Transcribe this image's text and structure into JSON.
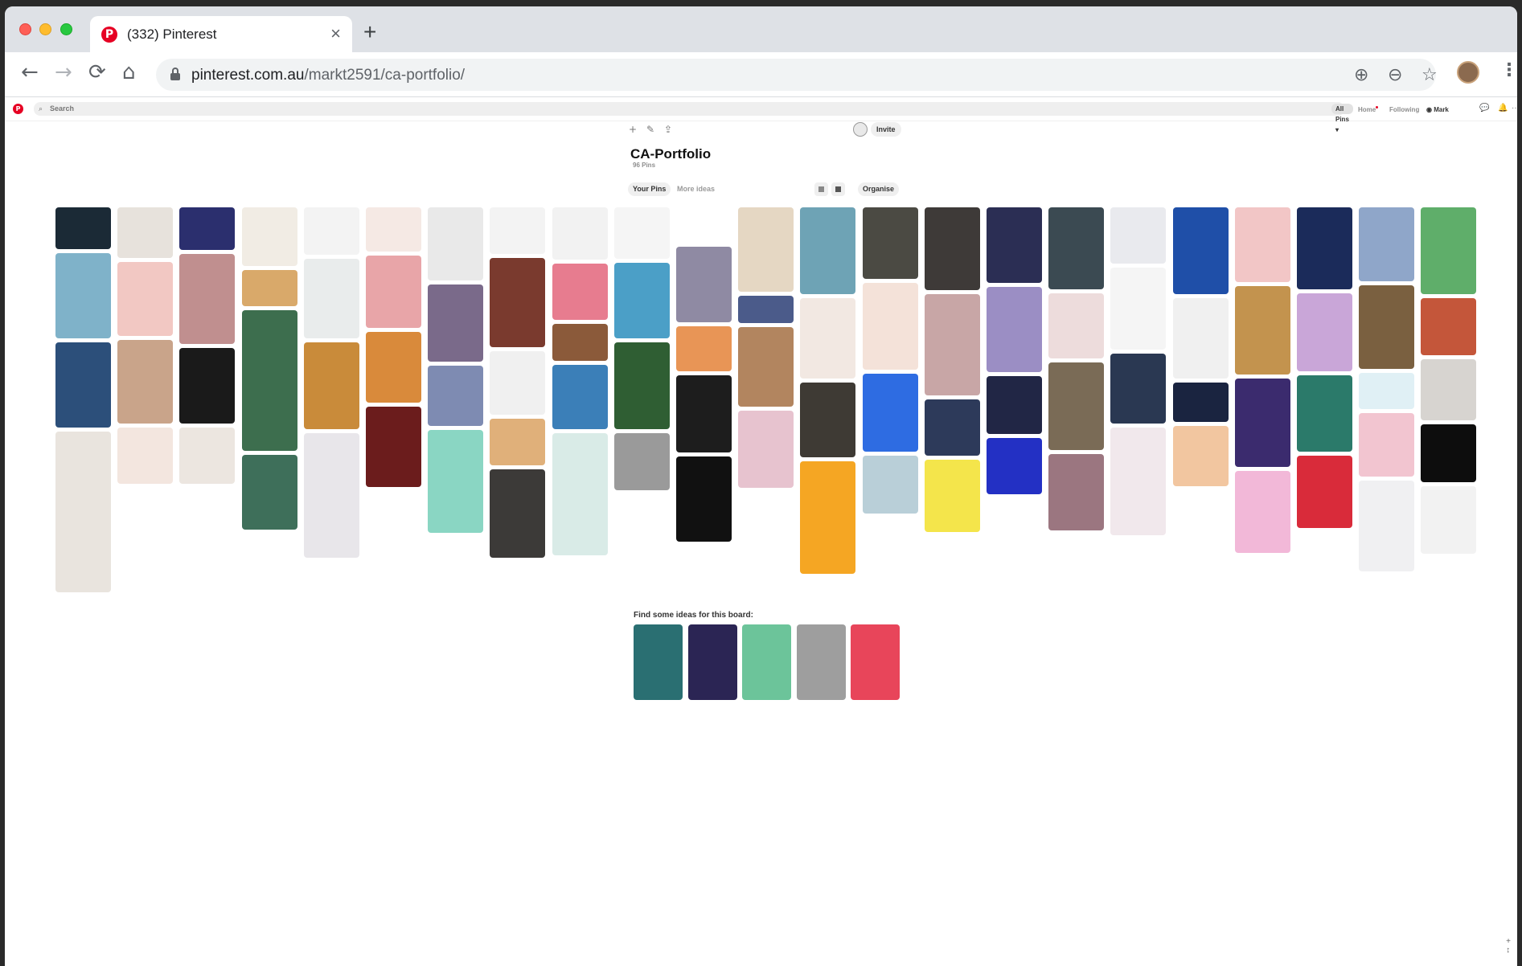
{
  "browser": {
    "tab_title": "(332) Pinterest",
    "tab_favicon": "P",
    "tab_close": "×",
    "new_tab": "+",
    "url_domain": "pinterest.com.au",
    "url_path": "/markt2591/ca-portfolio/",
    "nav": {
      "back": "←",
      "forward": "→",
      "reload": "⟳",
      "home": "⌂"
    },
    "omni_icons": {
      "install": "⊕",
      "zoom": "⊖",
      "bookmark": "☆"
    },
    "menu": "⋮"
  },
  "pinterest_header": {
    "logo": "P",
    "search_icon": "⌕",
    "search_placeholder": "Search",
    "filter": "All Pins ▾",
    "home": "Home",
    "following": "Following",
    "user": "Mark",
    "messages_icon": "💬",
    "notifications_icon": "🔔",
    "more_icon": "···"
  },
  "board": {
    "tools": {
      "add": "+",
      "edit": "✎",
      "share": "⇪"
    },
    "invite_label": "Invite",
    "title": "CA-Portfolio",
    "count": "96 Pins",
    "tabs": {
      "your_pins": "Your Pins",
      "more_ideas": "More ideas"
    },
    "organise": "Organise"
  },
  "pin_colors": [
    [
      "#1b2a36",
      "#7fb2c9",
      "#2c4f7a",
      "#e9e4de"
    ],
    [
      "#e7e2dc",
      "#f2c8c3",
      "#c9a48a",
      "#f3e6df"
    ],
    [
      "#2b2f6e",
      "#c08f8f",
      "#1a1a1a",
      "#ece6e0"
    ],
    [
      "#f1ece4",
      "#d9a96a",
      "#3d6e4e",
      "#3e6f5a"
    ],
    [
      "#f3f3f3",
      "#e9ecec",
      "#c98b3a",
      "#e8e6ea"
    ],
    [
      "#f5e9e4",
      "#e8a5a8",
      "#d98a3b",
      "#6b1c1c"
    ],
    [
      "#e9e9e9",
      "#7a6a8a",
      "#7e8bb2",
      "#8ad6c3"
    ],
    [
      "#f3f3f3",
      "#7a3a2e",
      "#f0f0f0",
      "#e0b07a",
      "#3c3a38"
    ],
    [
      "#f2f2f2",
      "#e77c8f",
      "#8b5a3a",
      "#3b7fb8",
      "#d9ebe7"
    ],
    [
      "#f5f5f5",
      "#4b9fc7",
      "#2f5e33",
      "#9a9a9a"
    ],
    [
      "#ffffff",
      "#8f8aa3",
      "#e89556",
      "#1d1d1d",
      "#111111"
    ],
    [
      "#e5d7c3",
      "#4b5b8a",
      "#b2855f",
      "#e7c3cf"
    ],
    [
      "#6ea3b5",
      "#f2e8e2",
      "#3e3a34",
      "#f5a623"
    ],
    [
      "#4b4a43",
      "#f4e2d9",
      "#2e6ce2",
      "#b9cfd8"
    ],
    [
      "#3e3a38",
      "#c8a6a6",
      "#2d3a5a",
      "#f4e54b"
    ],
    [
      "#2b2e54",
      "#9b8ec4",
      "#212645",
      "#2330c4"
    ],
    [
      "#3b4a52",
      "#eddcdc",
      "#7a6b56",
      "#9b7680"
    ],
    [
      "#e9eaee",
      "#f5f5f5",
      "#2a3852",
      "#f1e8ec"
    ],
    [
      "#1f4fa8",
      "#f0f0f0",
      "#1a2440",
      "#f2c6a0"
    ],
    [
      "#f2c6c6",
      "#c3934e",
      "#3b2b6e",
      "#f2b8d8"
    ],
    [
      "#1b2b5a",
      "#c9a6d8",
      "#2b7a6a",
      "#d92b3a"
    ],
    [
      "#8fa6c9",
      "#7a6040",
      "#e0f0f5",
      "#f2c5d0",
      "#f0f0f2"
    ],
    [
      "#5fae6a",
      "#c4563a",
      "#d7d4d0",
      "#0d0d0d",
      "#f2f2f2"
    ]
  ],
  "ideas_label": "Find some ideas for this board:",
  "idea_colors": [
    "#2a6f72",
    "#2b2554",
    "#6cc49a",
    "#9e9e9e",
    "#e8455a"
  ],
  "scroll_corner": "+\n↕"
}
